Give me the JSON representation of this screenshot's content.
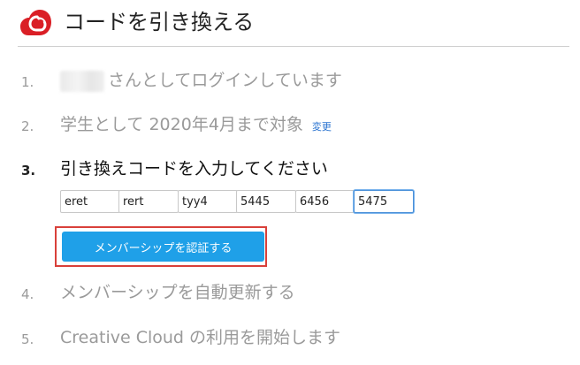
{
  "header": {
    "logo_icon": "creative-cloud-icon",
    "title": "コードを引き換える",
    "brand_color": "#da1f26"
  },
  "steps": [
    {
      "number": "1.",
      "text": "さんとしてログインしています",
      "state": "done"
    },
    {
      "number": "2.",
      "text": "学生として 2020年4月まで対象",
      "state": "done",
      "link": "変更"
    },
    {
      "number": "3.",
      "text": "引き換えコードを入力してください",
      "state": "active"
    },
    {
      "number": "4.",
      "text": "メンバーシップを自動更新する",
      "state": "pending"
    },
    {
      "number": "5.",
      "text": "Creative Cloud の利用を開始します",
      "state": "pending"
    }
  ],
  "code_fields": [
    {
      "value": "eret"
    },
    {
      "value": "rert"
    },
    {
      "value": "tyy4"
    },
    {
      "value": "5445"
    },
    {
      "value": "6456"
    },
    {
      "value": "5475",
      "focused": true
    }
  ],
  "verify_button": {
    "label": "メンバーシップを認証する",
    "color": "#1fa0e8",
    "highlight_color": "#d9403a"
  }
}
